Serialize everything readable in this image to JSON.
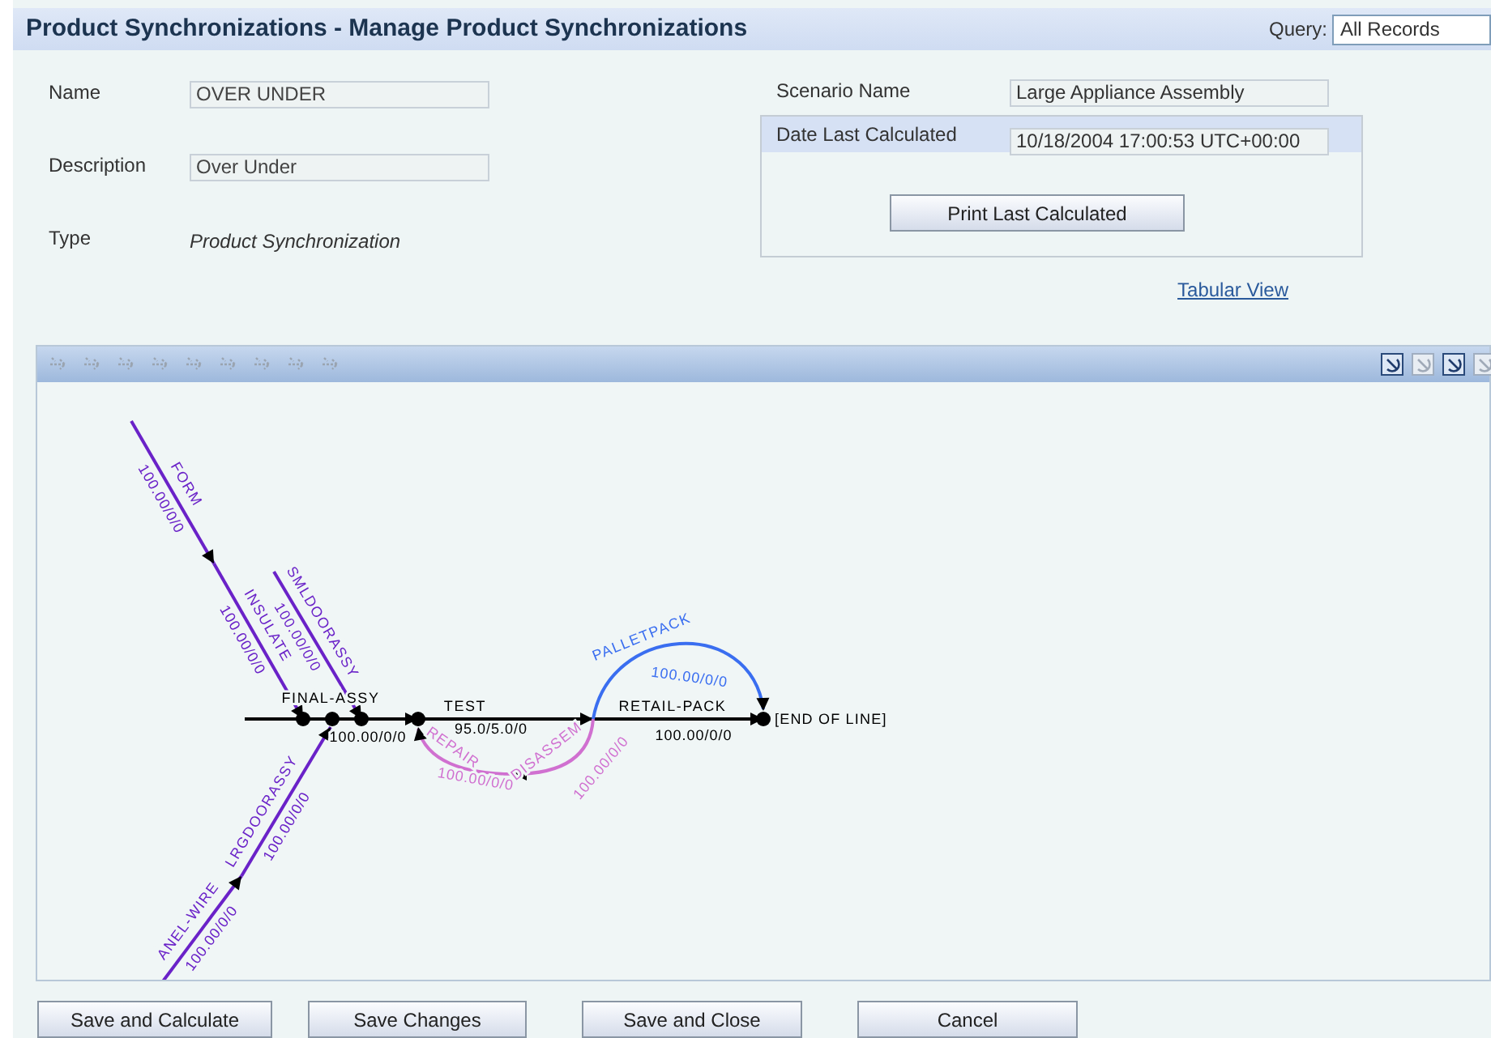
{
  "header": {
    "title": "Product Synchronizations - Manage Product Synchronizations",
    "query_label": "Query:",
    "query_value": "All Records"
  },
  "fields_left": [
    {
      "label": "Name",
      "kind": "input",
      "value": "OVER UNDER"
    },
    {
      "label": "Description",
      "kind": "input",
      "value": "Over Under"
    },
    {
      "label": "Type",
      "kind": "text",
      "value": "Product Synchronization"
    }
  ],
  "scenario": {
    "label": "Scenario Name",
    "value": "Large Appliance Assembly"
  },
  "calculation": {
    "label": "Date Last Calculated",
    "value": "10/18/2004 17:00:53 UTC+00:00",
    "button": "Print Last Calculated"
  },
  "tabular_view_link": "Tabular View",
  "toolbar": {
    "left_tools": [
      {
        "disabled": true
      },
      {
        "disabled": true
      },
      {
        "disabled": true
      },
      {
        "disabled": true
      },
      {
        "disabled": true
      },
      {
        "disabled": true
      },
      {
        "disabled": true
      },
      {
        "disabled": true
      },
      {
        "disabled": true
      }
    ],
    "right_tools": [
      {
        "disabled": false
      },
      {
        "disabled": true
      },
      {
        "disabled": false
      },
      {
        "disabled": true
      }
    ]
  },
  "diagram": {
    "edges": [
      {
        "label": "FORM",
        "value": "100.00/0/0",
        "color": "#6a22c8"
      },
      {
        "label": "INSULATE",
        "value": "100.00/0/0",
        "color": "#6a22c8"
      },
      {
        "label": "SMLDOORASSY",
        "value": "100.00/0/0",
        "color": "#6a22c8"
      },
      {
        "label": "ANEL-WIRE",
        "value": "100.00/0/0",
        "color": "#6a22c8"
      },
      {
        "label": "LRGDOORASSY",
        "value": "100.00/0/0",
        "color": "#6a22c8"
      },
      {
        "label": "FINAL-ASSY",
        "value": "100.00/0/0",
        "color": "#000000"
      },
      {
        "label": "TEST",
        "value": "95.0/5.0/0",
        "color": "#000000"
      },
      {
        "label": "RETAIL-PACK",
        "value": "100.00/0/0",
        "color": "#000000"
      },
      {
        "label": "PALLETPACK",
        "value": "100.00/0/0",
        "color": "#3a6ef0"
      },
      {
        "label": "DISASSEM",
        "value": "100.00/0/0",
        "color": "#d070d0"
      },
      {
        "label": "REPAIR",
        "value": "100.00/0/0",
        "color": "#d070d0"
      }
    ],
    "end_label": "[END OF LINE]"
  },
  "buttons": [
    "Save and Calculate",
    "Save Changes",
    "Save and Close",
    "Cancel"
  ]
}
